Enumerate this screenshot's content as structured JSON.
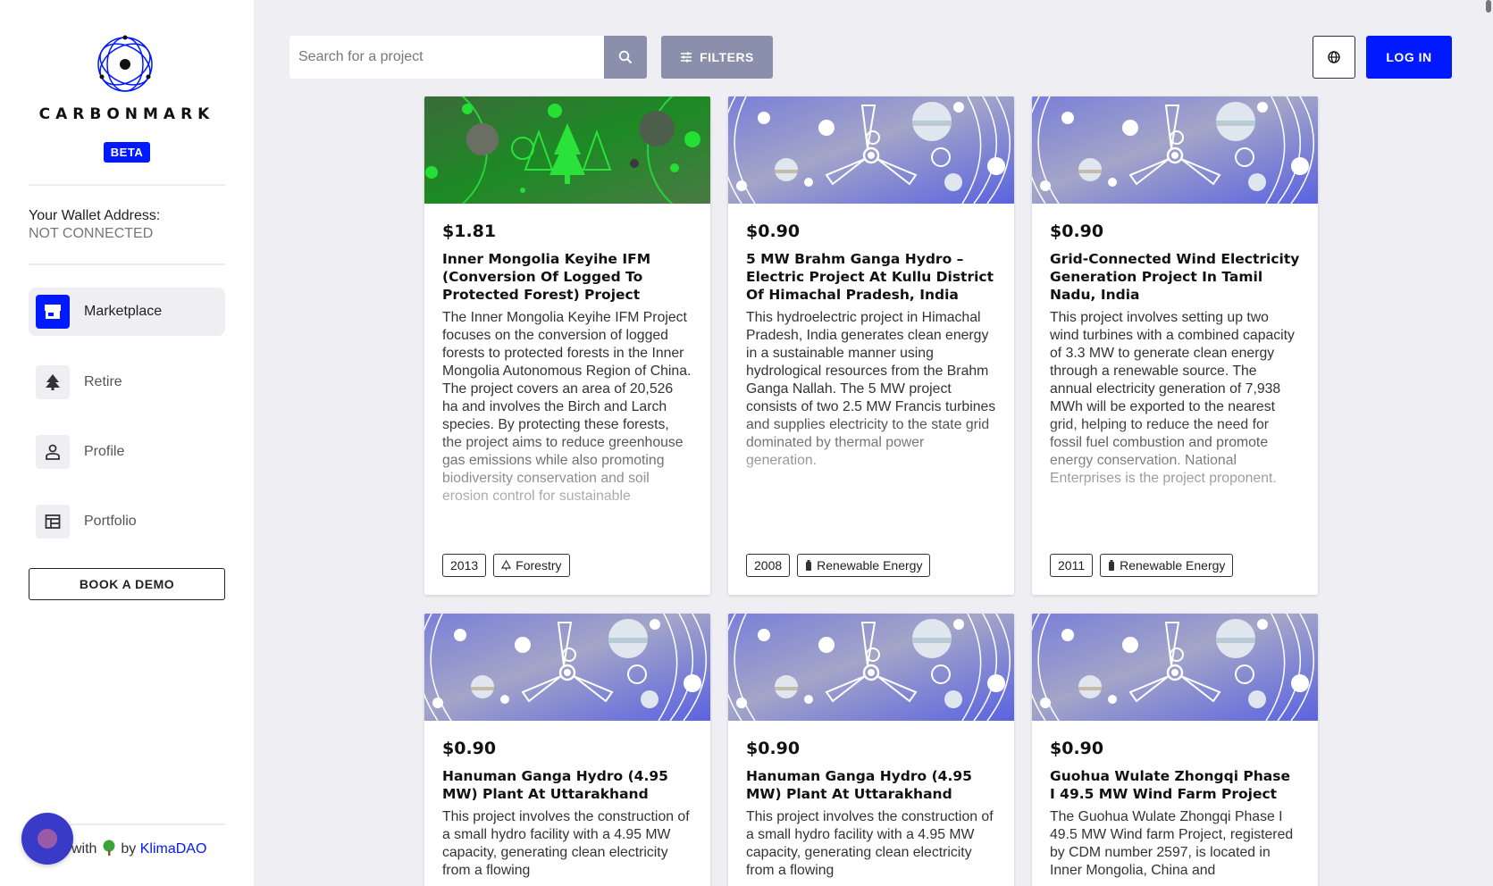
{
  "sidebar": {
    "brand": "CARBONMARK",
    "beta": "BETA",
    "wallet_label": "Your Wallet Address:",
    "wallet_value": "NOT CONNECTED",
    "nav": [
      {
        "label": "Marketplace",
        "icon": "store-icon",
        "active": true
      },
      {
        "label": "Retire",
        "icon": "tree-icon",
        "active": false
      },
      {
        "label": "Profile",
        "icon": "person-icon",
        "active": false
      },
      {
        "label": "Portfolio",
        "icon": "portfolio-icon",
        "active": false
      }
    ],
    "book_demo": "BOOK A DEMO",
    "footer": {
      "made_with": "with",
      "by": "by",
      "link": "KlimaDAO"
    }
  },
  "topbar": {
    "search_placeholder": "Search for a project",
    "filters_label": "FILTERS",
    "login_label": "LOG IN"
  },
  "cards": [
    {
      "price": "$1.81",
      "title": "Inner Mongolia Keyihe IFM (Conversion Of Logged To Protected Forest) Project",
      "description": "The Inner Mongolia Keyihe IFM Project focuses on the conversion of logged forests to protected forests in the Inner Mongolia Autonomous Region of China. The project covers an area of 20,526 ha and involves the Birch and Larch species. By protecting these forests, the project aims to reduce greenhouse gas emissions while also promoting biodiversity conservation and soil erosion control for sustainable",
      "year": "2013",
      "category": "Forestry",
      "banner": "forest"
    },
    {
      "price": "$0.90",
      "title": "5 MW Brahm Ganga Hydro – Electric Project At Kullu District Of Himachal Pradesh, India",
      "description": "This hydroelectric project in Himachal Pradesh, India generates clean energy in a sustainable manner using hydrological resources from the Brahm Ganga Nallah. The 5 MW project consists of two 2.5 MW Francis turbines and supplies electricity to the state grid dominated by thermal power generation.",
      "year": "2008",
      "category": "Renewable Energy",
      "banner": "energy"
    },
    {
      "price": "$0.90",
      "title": "Grid-Connected Wind Electricity Generation Project In Tamil Nadu, India",
      "description": "This project involves setting up two wind turbines with a combined capacity of 3.3 MW to generate clean energy through a renewable source. The annual electricity generation of 7,938 MWh will be exported to the nearest grid, helping to reduce the need for fossil fuel combustion and promote energy conservation. National Enterprises is the project proponent.",
      "year": "2011",
      "category": "Renewable Energy",
      "banner": "energy"
    },
    {
      "price": "$0.90",
      "title": "Hanuman Ganga Hydro (4.95 MW) Plant At Uttarakhand",
      "description": "This project involves the construction of a small hydro facility with a 4.95 MW capacity, generating clean electricity from a flowing",
      "banner": "energy"
    },
    {
      "price": "$0.90",
      "title": "Hanuman Ganga Hydro (4.95 MW) Plant At Uttarakhand",
      "description": "This project involves the construction of a small hydro facility with a 4.95 MW capacity, generating clean electricity from a flowing",
      "banner": "energy"
    },
    {
      "price": "$0.90",
      "title": "Guohua Wulate Zhongqi Phase I 49.5 MW Wind Farm Project",
      "description": "The Guohua Wulate Zhongqi Phase I 49.5 MW Wind farm Project, registered by CDM number 2597, is located in Inner Mongolia, China and",
      "banner": "energy"
    }
  ],
  "colors": {
    "accent": "#0019ff",
    "page_bg": "#eeeef3",
    "button_grey": "#8a8fab",
    "forest_green": "#1aa52a",
    "energy_purple": "#8d8fc8"
  }
}
